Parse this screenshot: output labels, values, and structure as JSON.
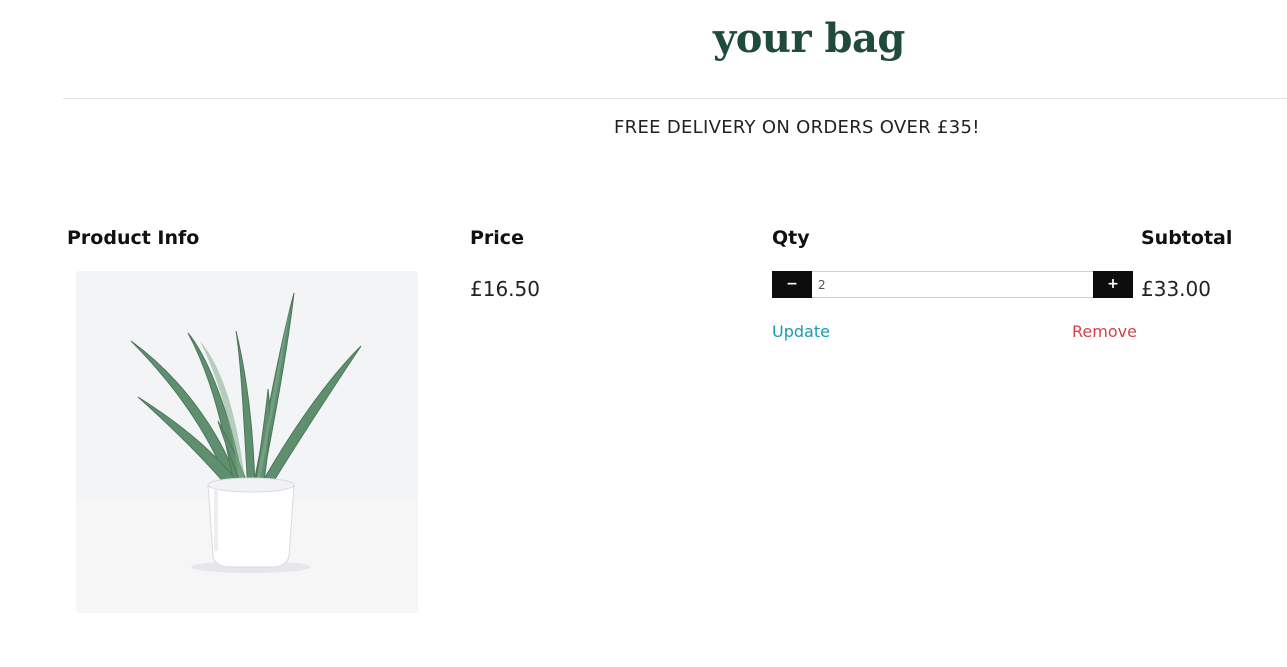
{
  "page": {
    "title": "your bag",
    "banner": "FREE DELIVERY ON ORDERS OVER £35!"
  },
  "table": {
    "headers": {
      "product_info": "Product Info",
      "price": "Price",
      "qty": "Qty",
      "subtotal": "Subtotal"
    }
  },
  "item": {
    "image_alt": "Aloe vera plant in white pot",
    "price": "£16.50",
    "quantity": "2",
    "subtotal": "£33.00",
    "decrement_label": "−",
    "increment_label": "+",
    "update_label": "Update",
    "remove_label": "Remove"
  },
  "colors": {
    "title": "#1f4a3d",
    "update_link": "#1a9bb0",
    "remove_link": "#d9404a",
    "qty_button": "#0d0d0d"
  },
  "icons": {
    "decrement": "minus-icon",
    "increment": "plus-icon"
  }
}
